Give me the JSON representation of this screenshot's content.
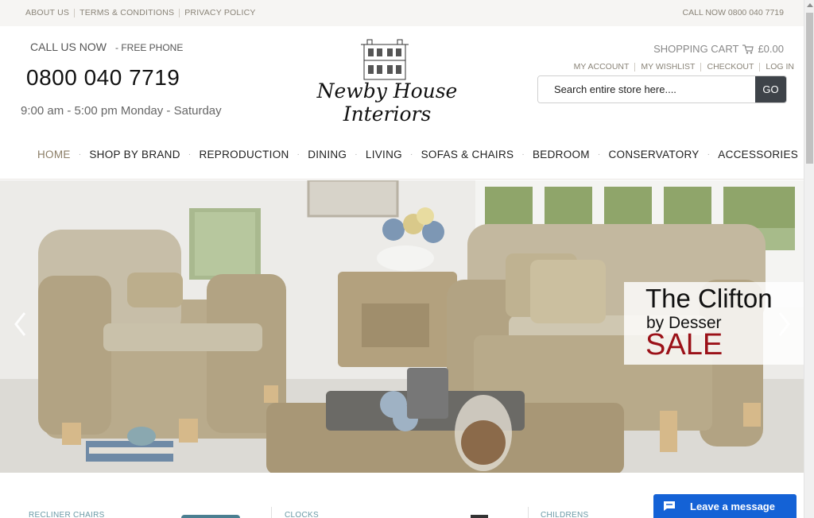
{
  "topbar": {
    "links": [
      "ABOUT US",
      "TERMS & CONDITIONS",
      "PRIVACY POLICY"
    ],
    "call_now": "CALL NOW 0800 040 7719"
  },
  "header": {
    "call_us": "CALL US NOW",
    "free_phone": "-  FREE PHONE",
    "phone": "0800 040 7719",
    "hours": "9:00 am - 5:00 pm Monday - Saturday",
    "logo_text": "Newby House Interiors",
    "cart_label": "SHOPPING CART",
    "cart_total": "£0.00",
    "account_links": [
      "MY ACCOUNT",
      "MY WISHLIST",
      "CHECKOUT",
      "LOG IN"
    ],
    "search_placeholder": "Search entire store here....",
    "search_button": "GO"
  },
  "nav": {
    "items": [
      "HOME",
      "SHOP BY BRAND",
      "REPRODUCTION",
      "DINING",
      "LIVING",
      "SOFAS & CHAIRS",
      "BEDROOM",
      "CONSERVATORY",
      "ACCESSORIES"
    ],
    "active": "HOME"
  },
  "hero": {
    "title": "The Clifton",
    "subtitle": "by Desser",
    "sale": "SALE"
  },
  "categories": [
    "RECLINER CHAIRS",
    "CLOCKS",
    "CHILDRENS"
  ],
  "chat": {
    "label": "Leave a message"
  },
  "colors": {
    "accent_active": "#8b7d66",
    "sale_red": "#9b1118",
    "go_button": "#3e4349",
    "chat_blue": "#1462d6",
    "category_text": "#6b9aa6"
  }
}
